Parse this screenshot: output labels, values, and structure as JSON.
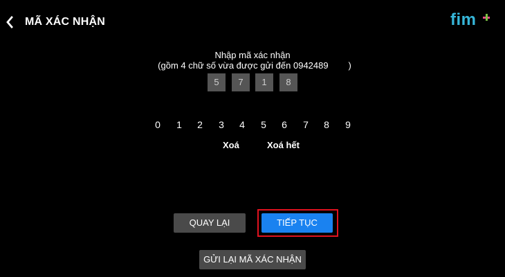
{
  "header": {
    "title": "MÃ XÁC NHẬN",
    "back_icon": "chevron-left-icon",
    "logo_text": "fim",
    "logo_colors": {
      "text": "#36b6d9",
      "plus_h": "#ea4c89",
      "plus_v": "#7ac143"
    }
  },
  "instruction": {
    "line1": "Nhập mã xác nhận",
    "line2": "(gồm 4 chữ số vừa được gửi đến 0942489        )"
  },
  "code": {
    "digits": [
      "5",
      "7",
      "1",
      "8"
    ]
  },
  "keypad": {
    "keys": [
      "0",
      "1",
      "2",
      "3",
      "4",
      "5",
      "6",
      "7",
      "8",
      "9"
    ],
    "delete_label": "Xoá",
    "delete_all_label": "Xoá hết"
  },
  "buttons": {
    "back_label": "QUAY LẠI",
    "continue_label": "TIẾP TỤC",
    "resend_label": "GỬI LẠI MÃ XÁC NHẬN"
  },
  "colors": {
    "background": "#000000",
    "accent": "#1a82f0",
    "highlight": "#e1121f",
    "secondary_button": "#4a4a4a"
  }
}
